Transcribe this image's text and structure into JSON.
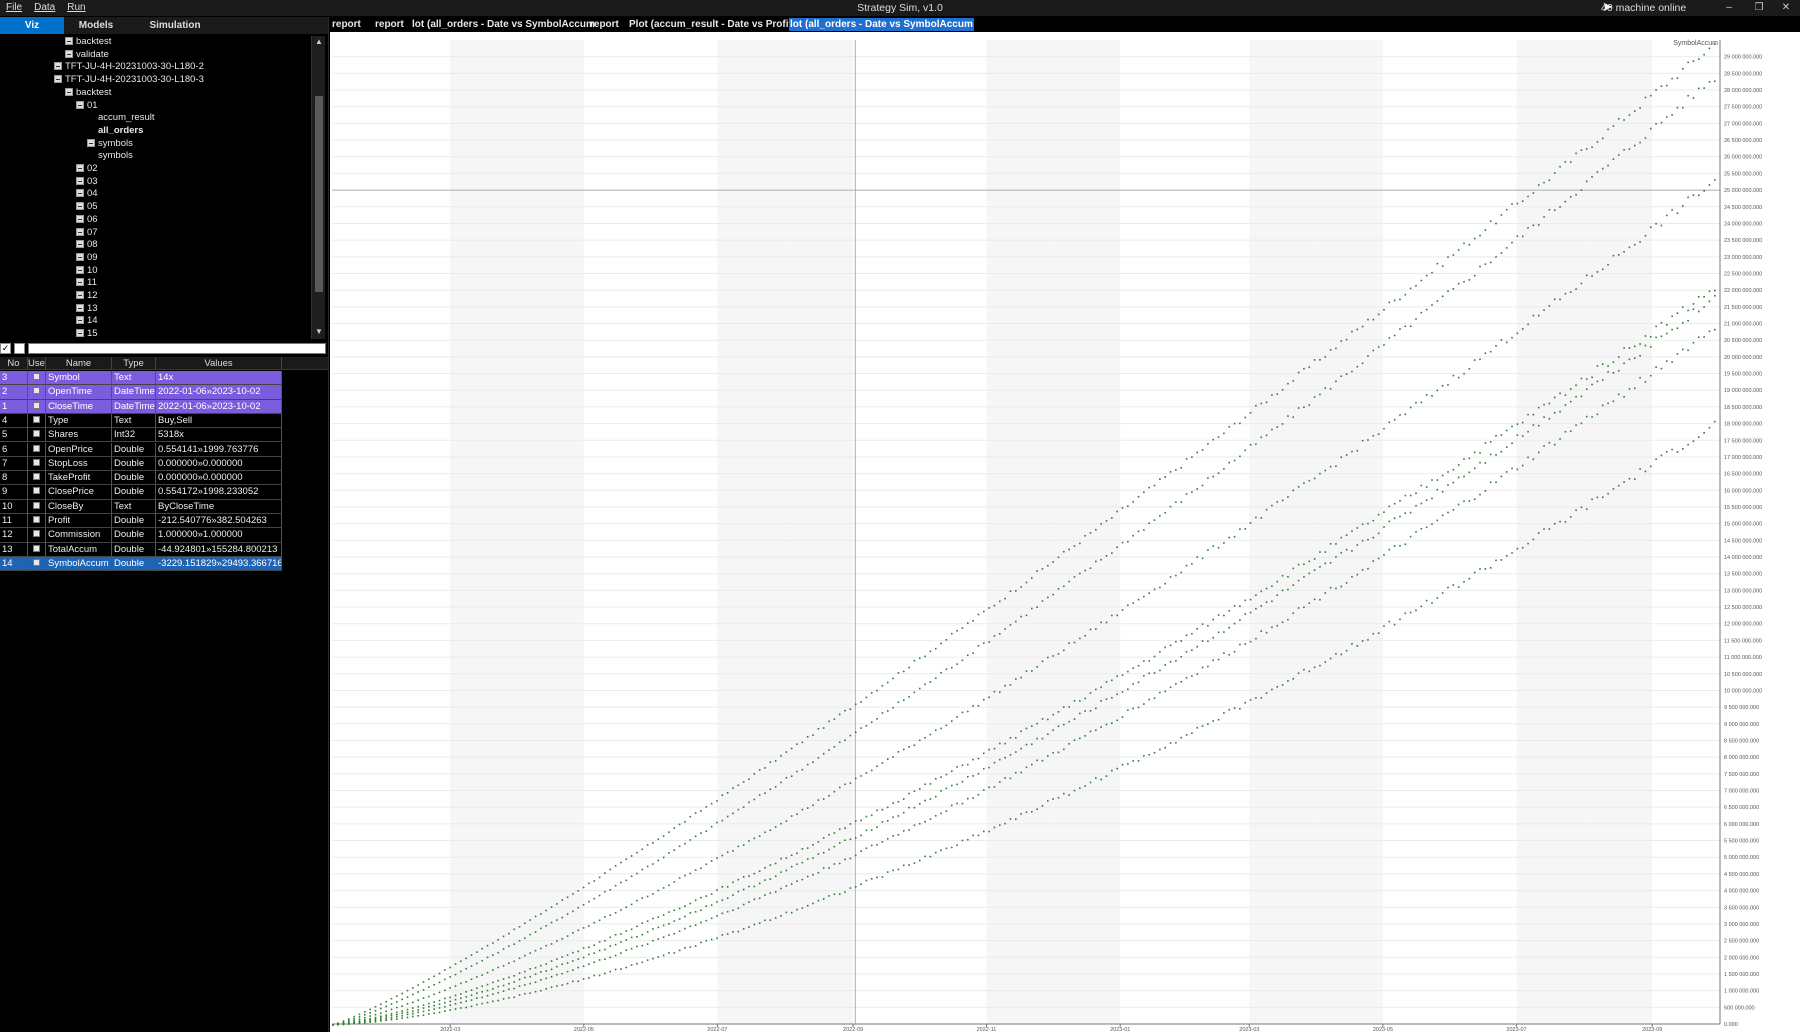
{
  "window": {
    "title": "Strategy Sim, v1.0",
    "status": "40 machine online",
    "controls": [
      "–",
      "❐",
      "✕"
    ]
  },
  "menu": [
    "File",
    "Data",
    "Run"
  ],
  "left_tabs": [
    {
      "label": "Viz",
      "active": true
    },
    {
      "label": "Models",
      "active": false
    },
    {
      "label": "Simulation",
      "active": false
    }
  ],
  "tree": [
    {
      "label": "backtest",
      "level": 5,
      "box": true
    },
    {
      "label": "validate",
      "level": 5,
      "box": true
    },
    {
      "label": "TFT-JU-4H-20231003-30-L180-2",
      "level": 4,
      "box": true
    },
    {
      "label": "TFT-JU-4H-20231003-30-L180-3",
      "level": 4,
      "box": true
    },
    {
      "label": "backtest",
      "level": 5,
      "box": true
    },
    {
      "label": "01",
      "level": 6,
      "box": true
    },
    {
      "label": "accum_result",
      "level": 8,
      "box": false
    },
    {
      "label": "all_orders",
      "level": 8,
      "box": false,
      "bold": true
    },
    {
      "label": "symbols",
      "level": 7,
      "box": true
    },
    {
      "label": "symbols",
      "level": 8,
      "box": false
    },
    {
      "label": "02",
      "level": 6,
      "box": true
    },
    {
      "label": "03",
      "level": 6,
      "box": true
    },
    {
      "label": "04",
      "level": 6,
      "box": true
    },
    {
      "label": "05",
      "level": 6,
      "box": true
    },
    {
      "label": "06",
      "level": 6,
      "box": true
    },
    {
      "label": "07",
      "level": 6,
      "box": true
    },
    {
      "label": "08",
      "level": 6,
      "box": true
    },
    {
      "label": "09",
      "level": 6,
      "box": true
    },
    {
      "label": "10",
      "level": 6,
      "box": true
    },
    {
      "label": "11",
      "level": 6,
      "box": true
    },
    {
      "label": "12",
      "level": 6,
      "box": true
    },
    {
      "label": "13",
      "level": 6,
      "box": true
    },
    {
      "label": "14",
      "level": 6,
      "box": true
    },
    {
      "label": "15",
      "level": 6,
      "box": true
    }
  ],
  "grid": {
    "headers": [
      "No",
      "Use",
      "Name",
      "Type",
      "Values"
    ],
    "rows": [
      {
        "no": "3",
        "name": "Symbol",
        "type": "Text",
        "values": "14x",
        "state": "sel"
      },
      {
        "no": "2",
        "name": "OpenTime",
        "type": "DateTime",
        "values": "2022-01-06»2023-10-02",
        "state": "sel"
      },
      {
        "no": "1",
        "name": "CloseTime",
        "type": "DateTime",
        "values": "2022-01-06»2023-10-02",
        "state": "sel"
      },
      {
        "no": "4",
        "name": "Type",
        "type": "Text",
        "values": "Buy,Sell",
        "state": ""
      },
      {
        "no": "5",
        "name": "Shares",
        "type": "Int32",
        "values": "5318x",
        "state": ""
      },
      {
        "no": "6",
        "name": "OpenPrice",
        "type": "Double",
        "values": "0.554141»1999.763776",
        "state": ""
      },
      {
        "no": "7",
        "name": "StopLoss",
        "type": "Double",
        "values": "0.000000»0.000000",
        "state": ""
      },
      {
        "no": "8",
        "name": "TakeProfit",
        "type": "Double",
        "values": "0.000000»0.000000",
        "state": ""
      },
      {
        "no": "9",
        "name": "ClosePrice",
        "type": "Double",
        "values": "0.554172»1998.233052",
        "state": ""
      },
      {
        "no": "10",
        "name": "CloseBy",
        "type": "Text",
        "values": "ByCloseTime",
        "state": ""
      },
      {
        "no": "11",
        "name": "Profit",
        "type": "Double",
        "values": "-212.540776»382.504263",
        "state": ""
      },
      {
        "no": "12",
        "name": "Commission",
        "type": "Double",
        "values": "1.000000»1.000000",
        "state": ""
      },
      {
        "no": "13",
        "name": "TotalAccum",
        "type": "Double",
        "values": "-44.924801»155284.800213",
        "state": ""
      },
      {
        "no": "14",
        "name": "SymbolAccum",
        "type": "Double",
        "values": "-3229.151829»29493.366716",
        "state": "cur"
      }
    ]
  },
  "doc_tabs": [
    {
      "label": "report",
      "active": false
    },
    {
      "label": "report",
      "active": false
    },
    {
      "label": "lot (all_orders - Date vs SymbolAccum",
      "active": false
    },
    {
      "label": "report",
      "active": false
    },
    {
      "label": "Plot (accum_result - Date vs Profit)",
      "active": false
    },
    {
      "label": "lot (all_orders - Date vs SymbolAccum",
      "active": true
    }
  ],
  "chart_data": {
    "type": "scatter",
    "legend": "SymbolAccum",
    "legend_position": "top-right",
    "x_ticks": [
      "2022-03",
      "2022-05",
      "2022-07",
      "2022-09",
      "2022-11",
      "2023-01",
      "2023-03",
      "2023-05",
      "2023-07",
      "2023-09"
    ],
    "xlim": [
      "2022-01-06",
      "2023-10-02"
    ],
    "ylim": [
      0,
      29500000
    ],
    "y_ticks": [
      0,
      500000,
      1000000,
      1500000,
      2000000,
      2500000,
      3000000,
      3500000,
      4000000,
      4500000,
      5000000,
      5500000,
      6000000,
      6500000,
      7000000,
      7500000,
      8000000,
      8500000,
      9000000,
      9500000,
      10000000,
      10500000,
      11000000,
      11500000,
      12000000,
      12500000,
      13000000,
      13500000,
      14000000,
      14500000,
      15000000,
      15500000,
      16000000,
      16500000,
      17000000,
      17500000,
      18000000,
      18500000,
      19000000,
      19500000,
      20000000,
      20500000,
      21000000,
      21500000,
      22000000,
      22500000,
      23000000,
      23500000,
      24000000,
      24500000,
      25000000,
      25500000,
      26000000,
      26500000,
      27000000,
      27500000,
      28000000,
      28500000,
      29000000
    ],
    "point_color": "#2f7d2f",
    "grid": true,
    "crosshair": {
      "date": "2022-09-02",
      "value": 25000000
    },
    "series": [
      {
        "final": 29400000
      },
      {
        "final": 28400000
      },
      {
        "final": 25300000
      },
      {
        "final": 22100000
      },
      {
        "final": 21800000
      },
      {
        "final": 20900000
      },
      {
        "final": 18000000
      }
    ]
  }
}
